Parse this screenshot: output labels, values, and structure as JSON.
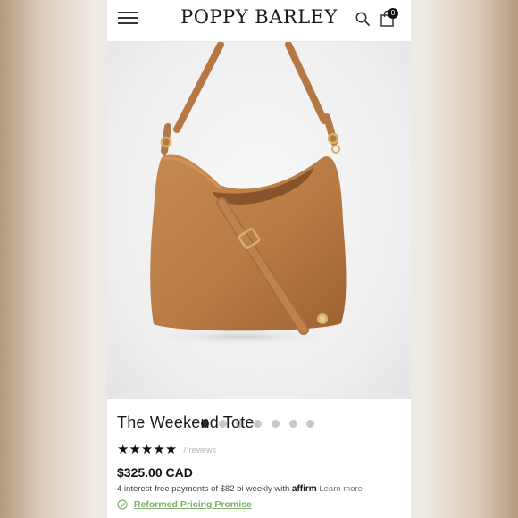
{
  "header": {
    "menu_icon": "hamburger-icon",
    "brand": "POPPY BARLEY",
    "search_icon": "search-icon",
    "cart_icon": "shopping-bag-icon",
    "cart_count": "0"
  },
  "gallery": {
    "image_count": 7,
    "active_index": 0,
    "colors": {
      "leather": "#b87a45",
      "background": "#eeeeee"
    }
  },
  "product": {
    "title": "The Weekend Tote",
    "rating": 5,
    "stars": "★★★★★",
    "reviews": "7 reviews",
    "price": "$325.00 CAD",
    "installment_text": "4 interest-free payments of $82 bi-weekly with",
    "affirm": "affirm",
    "learn_more": "Learn more",
    "promise": "Reformed Pricing Promise",
    "promise_color": "#7fb06f"
  }
}
